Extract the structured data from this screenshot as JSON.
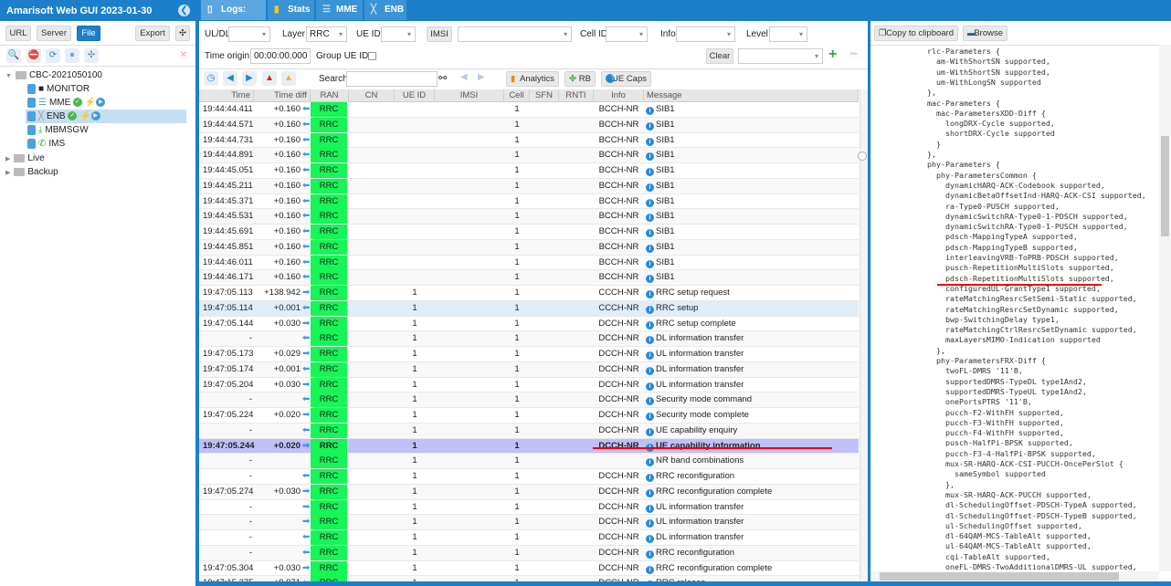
{
  "app": {
    "title": "Amarisoft Web GUI 2023-01-30"
  },
  "left": {
    "buttons": {
      "url": "URL",
      "server": "Server",
      "file": "File",
      "export": "Export"
    },
    "tree": [
      {
        "label": "CBC-2021050100",
        "level": 0,
        "type": "folder",
        "expanded": true
      },
      {
        "label": "MONITOR",
        "level": 1,
        "type": "monitor"
      },
      {
        "label": "MME",
        "level": 1,
        "type": "mme",
        "status": true
      },
      {
        "label": "ENB",
        "level": 1,
        "type": "enb",
        "status": true,
        "selected": true
      },
      {
        "label": "MBMSGW",
        "level": 1,
        "type": "mbmsgw"
      },
      {
        "label": "IMS",
        "level": 1,
        "type": "ims"
      },
      {
        "label": "Live",
        "level": 0,
        "type": "folder",
        "expanded": false
      },
      {
        "label": "Backup",
        "level": 0,
        "type": "folder",
        "expanded": false
      }
    ]
  },
  "tabs": [
    {
      "label": "Logs: 1002",
      "icon": "document-icon"
    },
    {
      "label": "Stats",
      "icon": "chart-icon"
    },
    {
      "label": "MME",
      "icon": "database-icon"
    },
    {
      "label": "ENB",
      "icon": "antenna-icon"
    }
  ],
  "filters": {
    "uldl_label": "UL/DL",
    "uldl": "",
    "layer_label": "Layer",
    "layer": "RRC",
    "ueid_label": "UE ID",
    "ueid": "",
    "imsi_button": "IMSI",
    "imsi": "",
    "cellid_label": "Cell ID",
    "cellid": "",
    "info_label": "Info",
    "info": "",
    "level_label": "Level",
    "level": "",
    "time_origin_label": "Time origin:",
    "time_origin": "00:00:00.000",
    "group_ueid_label": "Group UE ID:",
    "group_ueid_checked": false,
    "clear": "Clear",
    "search_label": "Search",
    "search": "",
    "analytics": "Analytics",
    "rb": "RB",
    "uecaps": "UE Caps"
  },
  "table": {
    "columns": [
      "Time",
      "Time diff",
      "RAN",
      "CN",
      "UE ID",
      "IMSI",
      "Cell",
      "SFN",
      "RNTI",
      "Info",
      "Message"
    ],
    "rows": [
      {
        "time": "19:44:44.411",
        "diff": "+0.160",
        "dir": "dl",
        "ran": "RRC",
        "ueid": "",
        "cell": "1",
        "info": "BCCH-NR",
        "msg": "SIB1"
      },
      {
        "time": "19:44:44.571",
        "diff": "+0.160",
        "dir": "dl",
        "ran": "RRC",
        "ueid": "",
        "cell": "1",
        "info": "BCCH-NR",
        "msg": "SIB1"
      },
      {
        "time": "19:44:44.731",
        "diff": "+0.160",
        "dir": "dl",
        "ran": "RRC",
        "ueid": "",
        "cell": "1",
        "info": "BCCH-NR",
        "msg": "SIB1"
      },
      {
        "time": "19:44:44.891",
        "diff": "+0.160",
        "dir": "dl",
        "ran": "RRC",
        "ueid": "",
        "cell": "1",
        "info": "BCCH-NR",
        "msg": "SIB1"
      },
      {
        "time": "19:44:45.051",
        "diff": "+0.160",
        "dir": "dl",
        "ran": "RRC",
        "ueid": "",
        "cell": "1",
        "info": "BCCH-NR",
        "msg": "SIB1"
      },
      {
        "time": "19:44:45.211",
        "diff": "+0.160",
        "dir": "dl",
        "ran": "RRC",
        "ueid": "",
        "cell": "1",
        "info": "BCCH-NR",
        "msg": "SIB1"
      },
      {
        "time": "19:44:45.371",
        "diff": "+0.160",
        "dir": "dl",
        "ran": "RRC",
        "ueid": "",
        "cell": "1",
        "info": "BCCH-NR",
        "msg": "SIB1"
      },
      {
        "time": "19:44:45.531",
        "diff": "+0.160",
        "dir": "dl",
        "ran": "RRC",
        "ueid": "",
        "cell": "1",
        "info": "BCCH-NR",
        "msg": "SIB1"
      },
      {
        "time": "19:44:45.691",
        "diff": "+0.160",
        "dir": "dl",
        "ran": "RRC",
        "ueid": "",
        "cell": "1",
        "info": "BCCH-NR",
        "msg": "SIB1"
      },
      {
        "time": "19:44:45.851",
        "diff": "+0.160",
        "dir": "dl",
        "ran": "RRC",
        "ueid": "",
        "cell": "1",
        "info": "BCCH-NR",
        "msg": "SIB1"
      },
      {
        "time": "19:44:46.011",
        "diff": "+0.160",
        "dir": "dl",
        "ran": "RRC",
        "ueid": "",
        "cell": "1",
        "info": "BCCH-NR",
        "msg": "SIB1"
      },
      {
        "time": "19:44:46.171",
        "diff": "+0.160",
        "dir": "dl",
        "ran": "RRC",
        "ueid": "",
        "cell": "1",
        "info": "BCCH-NR",
        "msg": "SIB1"
      },
      {
        "time": "19:47:05.113",
        "diff": "+138.942",
        "dir": "ul",
        "ran": "RRC",
        "ueid": "1",
        "cell": "1",
        "info": "CCCH-NR",
        "msg": "RRC setup request"
      },
      {
        "time": "19:47:05.114",
        "diff": "+0.001",
        "dir": "dl",
        "ran": "RRC",
        "ueid": "1",
        "cell": "1",
        "info": "CCCH-NR",
        "msg": "RRC setup",
        "hl": true
      },
      {
        "time": "19:47:05.144",
        "diff": "+0.030",
        "dir": "ul",
        "ran": "RRC",
        "ueid": "1",
        "cell": "1",
        "info": "DCCH-NR",
        "msg": "RRC setup complete"
      },
      {
        "time": "-",
        "diff": "",
        "dir": "dl",
        "ran": "RRC",
        "ueid": "1",
        "cell": "1",
        "info": "DCCH-NR",
        "msg": "DL information transfer"
      },
      {
        "time": "19:47:05.173",
        "diff": "+0.029",
        "dir": "ul",
        "ran": "RRC",
        "ueid": "1",
        "cell": "1",
        "info": "DCCH-NR",
        "msg": "UL information transfer"
      },
      {
        "time": "19:47:05.174",
        "diff": "+0.001",
        "dir": "dl",
        "ran": "RRC",
        "ueid": "1",
        "cell": "1",
        "info": "DCCH-NR",
        "msg": "DL information transfer"
      },
      {
        "time": "19:47:05.204",
        "diff": "+0.030",
        "dir": "ul",
        "ran": "RRC",
        "ueid": "1",
        "cell": "1",
        "info": "DCCH-NR",
        "msg": "UL information transfer"
      },
      {
        "time": "-",
        "diff": "",
        "dir": "dl",
        "ran": "RRC",
        "ueid": "1",
        "cell": "1",
        "info": "DCCH-NR",
        "msg": "Security mode command"
      },
      {
        "time": "19:47:05.224",
        "diff": "+0.020",
        "dir": "ul",
        "ran": "RRC",
        "ueid": "1",
        "cell": "1",
        "info": "DCCH-NR",
        "msg": "Security mode complete"
      },
      {
        "time": "-",
        "diff": "",
        "dir": "dl",
        "ran": "RRC",
        "ueid": "1",
        "cell": "1",
        "info": "DCCH-NR",
        "msg": "UE capability enquiry"
      },
      {
        "time": "19:47:05.244",
        "diff": "+0.020",
        "dir": "ul",
        "ran": "RRC",
        "ueid": "1",
        "cell": "1",
        "info": "DCCH-NR",
        "msg": "UE capability information",
        "selected": true
      },
      {
        "time": "-",
        "diff": "",
        "dir": "",
        "ran": "RRC",
        "ueid": "1",
        "cell": "1",
        "info": "",
        "msg": "NR band combinations"
      },
      {
        "time": "-",
        "diff": "",
        "dir": "dl",
        "ran": "RRC",
        "ueid": "1",
        "cell": "1",
        "info": "DCCH-NR",
        "msg": "RRC reconfiguration"
      },
      {
        "time": "19:47:05.274",
        "diff": "+0.030",
        "dir": "ul",
        "ran": "RRC",
        "ueid": "1",
        "cell": "1",
        "info": "DCCH-NR",
        "msg": "RRC reconfiguration complete"
      },
      {
        "time": "-",
        "diff": "",
        "dir": "ul",
        "ran": "RRC",
        "ueid": "1",
        "cell": "1",
        "info": "DCCH-NR",
        "msg": "UL information transfer"
      },
      {
        "time": "-",
        "diff": "",
        "dir": "ul",
        "ran": "RRC",
        "ueid": "1",
        "cell": "1",
        "info": "DCCH-NR",
        "msg": "UL information transfer"
      },
      {
        "time": "-",
        "diff": "",
        "dir": "dl",
        "ran": "RRC",
        "ueid": "1",
        "cell": "1",
        "info": "DCCH-NR",
        "msg": "DL information transfer"
      },
      {
        "time": "-",
        "diff": "",
        "dir": "dl",
        "ran": "RRC",
        "ueid": "1",
        "cell": "1",
        "info": "DCCH-NR",
        "msg": "RRC reconfiguration"
      },
      {
        "time": "19:47:05.304",
        "diff": "+0.030",
        "dir": "ul",
        "ran": "RRC",
        "ueid": "1",
        "cell": "1",
        "info": "DCCH-NR",
        "msg": "RRC reconfiguration complete"
      },
      {
        "time": "19:47:15.275",
        "diff": "+9.971",
        "dir": "dl",
        "ran": "RRC",
        "ueid": "1",
        "cell": "1",
        "info": "DCCH-NR",
        "msg": "RRC release"
      }
    ]
  },
  "right": {
    "copy": "Copy to clipboard",
    "browse": "Browse",
    "lines": [
      "rlc-Parameters {",
      "  am-WithShortSN supported,",
      "  um-WithShortSN supported,",
      "  um-WithLongSN supported",
      "},",
      "mac-Parameters {",
      "  mac-ParametersXDD-Diff {",
      "    longDRX-Cycle supported,",
      "    shortDRX-Cycle supported",
      "  }",
      "},",
      "phy-Parameters {",
      "  phy-ParametersCommon {",
      "    dynamicHARQ-ACK-Codebook supported,",
      "    dynamicBetaOffsetInd-HARQ-ACK-CSI supported,",
      "    ra-Type0-PUSCH supported,",
      "    dynamicSwitchRA-Type0-1-PDSCH supported,",
      "    dynamicSwitchRA-Type0-1-PUSCH supported,",
      "    pdsch-MappingTypeA supported,",
      "    pdsch-MappingTypeB supported,",
      "    interleavingVRB-ToPRB-PDSCH supported,",
      "    pusch-RepetitionMultiSlots supported,",
      "    pdsch-RepetitionMultiSlots supported,",
      "    configuredUL-GrantType1 supported,",
      "    rateMatchingResrcSetSemi-Static supported,",
      "    rateMatchingResrcSetDynamic supported,",
      "    bwp-SwitchingDelay type1,",
      "    rateMatchingCtrlResrcSetDynamic supported,",
      "    maxLayersMIMO-Indication supported",
      "  },",
      "  phy-ParametersFRX-Diff {",
      "    twoFL-DMRS '11'B,",
      "    supportedDMRS-TypeDL type1And2,",
      "    supportedDMRS-TypeUL type1And2,",
      "    onePortsPTRS '11'B,",
      "    pucch-F2-WithFH supported,",
      "    pucch-F3-WithFH supported,",
      "    pucch-F4-WithFH supported,",
      "    pusch-HalfPi-BPSK supported,",
      "    pucch-F3-4-HalfPi-BPSK supported,",
      "    mux-SR-HARQ-ACK-CSI-PUCCH-OncePerSlot {",
      "      sameSymbol supported",
      "    },",
      "    mux-SR-HARQ-ACK-PUCCH supported,",
      "    dl-SchedulingOffset-PDSCH-TypeA supported,",
      "    dl-SchedulingOffset-PDSCH-TypeB supported,",
      "    ul-SchedulingOffset supported,",
      "    dl-64QAM-MCS-TableAlt supported,",
      "    ul-64QAM-MCS-TableAlt supported,",
      "    cqi-TableAlt supported,",
      "    oneFL-DMRS-TwoAdditionalDMRS-UL supported,"
    ],
    "underlined_line": 22
  },
  "colors": {
    "brand": "#1b7fcc",
    "ran_rrc": "#17f557",
    "selected_row": "#c0c0f8",
    "annotation": "#e00000"
  }
}
